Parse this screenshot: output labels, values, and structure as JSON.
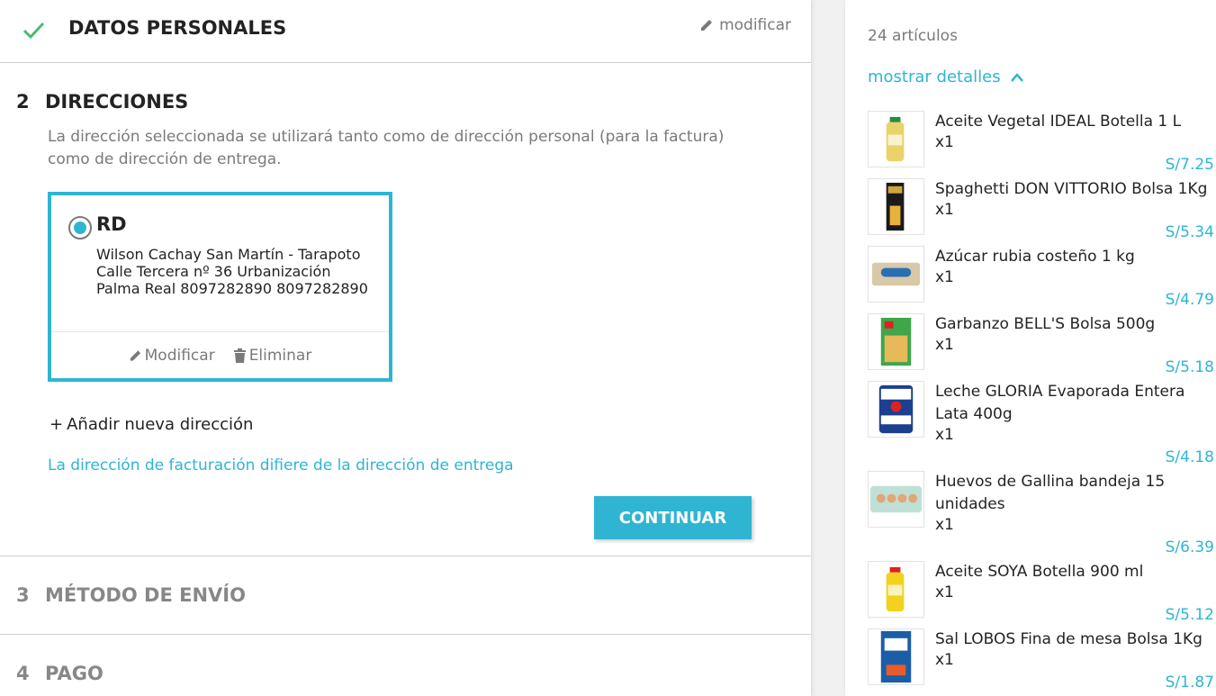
{
  "steps": {
    "personal": {
      "title": "DATOS PERSONALES",
      "modify_label": "modificar"
    },
    "addresses": {
      "number": "2",
      "title": "DIRECCIONES",
      "description": "La dirección seleccionada se utilizará tanto como de dirección personal (para la factura) como de dirección de entrega.",
      "card": {
        "alias": "RD",
        "lines": [
          "Wilson Cachay San Martín - Tarapoto",
          "Calle Tercera nº 36 Urbanización",
          "Palma Real 8097282890 8097282890"
        ],
        "edit_label": "Modificar",
        "delete_label": "Eliminar",
        "selected": true
      },
      "add_new_label": "Añadir nueva dirección",
      "add_new_prefix": "+",
      "billing_link": "La dirección de facturación difiere de la dirección de entrega",
      "continue_label": "CONTINUAR"
    },
    "shipping": {
      "number": "3",
      "title": "MÉTODO DE ENVÍO"
    },
    "payment": {
      "number": "4",
      "title": "PAGO"
    }
  },
  "summary": {
    "count_label": "24 artículos",
    "details_toggle": "mostrar detalles",
    "items": [
      {
        "name": "Aceite Vegetal IDEAL Botella 1 L",
        "qty": "x1",
        "price": "S/7.25",
        "icon": "oil-bottle-icon"
      },
      {
        "name": "Spaghetti DON VITTORIO Bolsa 1Kg",
        "qty": "x1",
        "price": "S/5.34",
        "icon": "pasta-package-icon"
      },
      {
        "name": "Azúcar rubia costeño 1 kg",
        "qty": "x1",
        "price": "S/4.79",
        "icon": "sugar-bag-icon"
      },
      {
        "name": "Garbanzo BELL'S Bolsa 500g",
        "qty": "x1",
        "price": "S/5.18",
        "icon": "chickpea-bag-icon"
      },
      {
        "name": "Leche GLORIA Evaporada Entera Lata 400g",
        "qty": "x1",
        "price": "S/4.18",
        "icon": "milk-can-icon"
      },
      {
        "name": "Huevos de Gallina bandeja 15 unidades",
        "qty": "x1",
        "price": "S/6.39",
        "icon": "egg-tray-icon"
      },
      {
        "name": "Aceite SOYA Botella 900 ml",
        "qty": "x1",
        "price": "S/5.12",
        "icon": "oil-bottle-icon"
      },
      {
        "name": "Sal LOBOS Fina de mesa Bolsa 1Kg",
        "qty": "x1",
        "price": "S/1.87",
        "icon": "salt-bag-icon"
      }
    ]
  },
  "colors": {
    "accent": "#2fb5d2",
    "check": "#4cbb6c",
    "muted": "#7a7a7a",
    "text": "#232323"
  }
}
